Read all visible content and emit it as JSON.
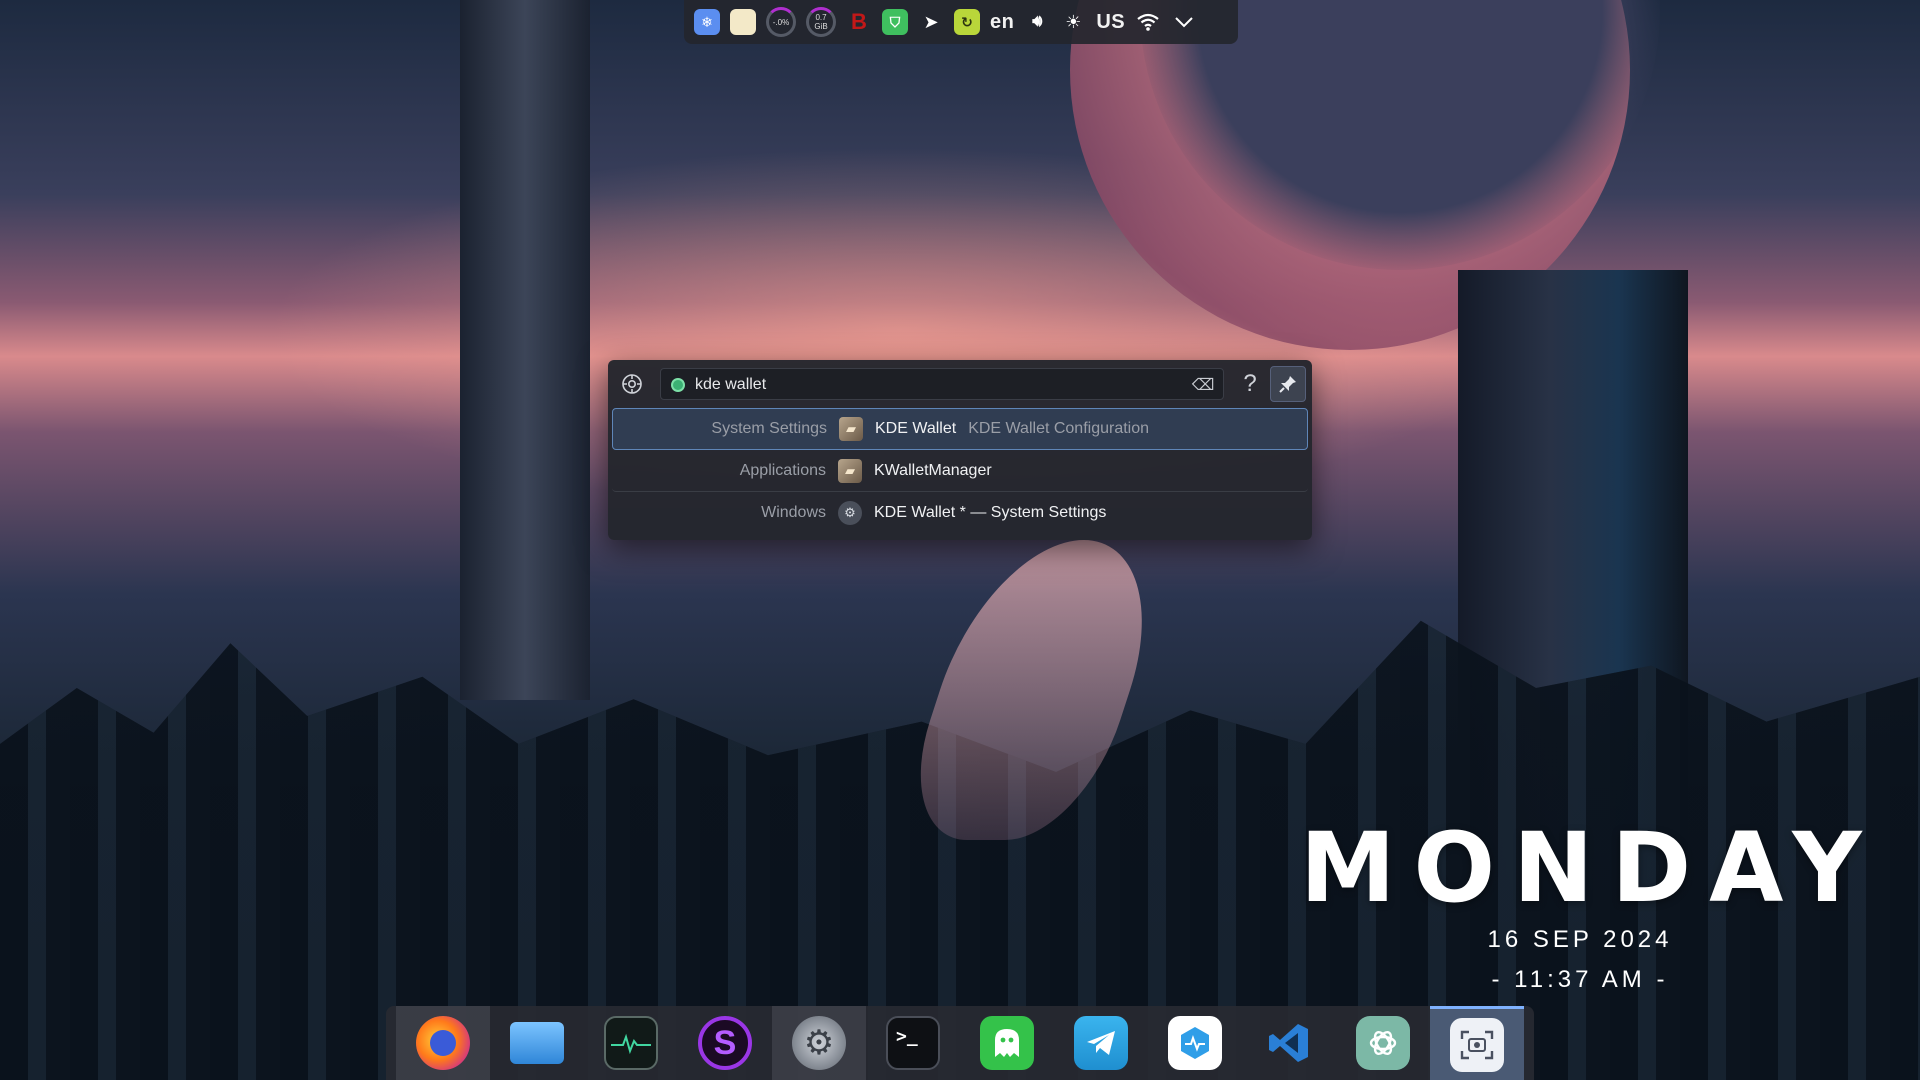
{
  "wallpaper": {
    "description_colors": [
      "#1d2a40",
      "#d98a8c",
      "#121a24"
    ]
  },
  "top_panel": {
    "tray": [
      {
        "name": "kde-connect-icon",
        "color": "#5b8ef0",
        "glyph": "❄"
      },
      {
        "name": "notes-icon",
        "color": "#f3e9c8",
        "glyph": ""
      },
      {
        "name": "cpu-meter",
        "text": "-.0%"
      },
      {
        "name": "memory-meter",
        "text": "0.7 GiB"
      },
      {
        "name": "b-app-icon",
        "color": "#c21818",
        "glyph": "B"
      },
      {
        "name": "shield-icon",
        "color": "#3fbf5f",
        "glyph": "⛉"
      },
      {
        "name": "telegram-icon",
        "color": "#00000000",
        "glyph": "➤"
      },
      {
        "name": "update-icon",
        "color": "#b9d63a",
        "glyph": "↻"
      }
    ],
    "language": "en",
    "keyboard_layout": "US",
    "expand_symbol": "⌄"
  },
  "krunner": {
    "query": "kde wallet",
    "help_symbol": "?",
    "results": [
      {
        "category": "System Settings",
        "title": "KDE Wallet",
        "subtitle": "KDE Wallet Configuration",
        "icon": "wallet",
        "selected": true
      },
      {
        "category": "Applications",
        "title": "KWalletManager",
        "subtitle": "",
        "icon": "wallet",
        "selected": false
      },
      {
        "category": "Windows",
        "title": "KDE Wallet * — System Settings",
        "subtitle": "",
        "icon": "settings",
        "selected": false
      }
    ]
  },
  "clock": {
    "day": "MONDAY",
    "date": "16 SEP 2024",
    "time": "- 11:37 AM -"
  },
  "dock": {
    "apps": [
      {
        "name": "firefox-icon",
        "color": "#f0f0f0",
        "glyph": "🦊",
        "state": "active"
      },
      {
        "name": "files-icon",
        "color": "#4aa6f0",
        "glyph": "▭",
        "state": ""
      },
      {
        "name": "system-monitor-icon",
        "color": "#1c2a26",
        "glyph": "⌇",
        "state": ""
      },
      {
        "name": "s-app-icon",
        "color": "#8c2bd6",
        "glyph": "S",
        "state": ""
      },
      {
        "name": "system-settings-icon",
        "color": "#9aa0a8",
        "glyph": "⚙",
        "state": "active"
      },
      {
        "name": "terminal-icon",
        "color": "#111318",
        "glyph": ">_",
        "state": ""
      },
      {
        "name": "ghost-app-icon",
        "color": "#35c24a",
        "glyph": "ᗣ",
        "state": ""
      },
      {
        "name": "telegram-app-icon",
        "color": "#2ba4e0",
        "glyph": "➤",
        "state": ""
      },
      {
        "name": "health-app-icon",
        "color": "#3a9fe6",
        "glyph": "⬢",
        "state": ""
      },
      {
        "name": "vscode-icon",
        "color": "#2a6ed1",
        "glyph": "⟩",
        "state": ""
      },
      {
        "name": "chatgpt-icon",
        "color": "#7cb8a6",
        "glyph": "✿",
        "state": ""
      },
      {
        "name": "screenshot-icon",
        "color": "#e8ecf2",
        "glyph": "⌜◉⌟",
        "state": "focused"
      }
    ]
  }
}
